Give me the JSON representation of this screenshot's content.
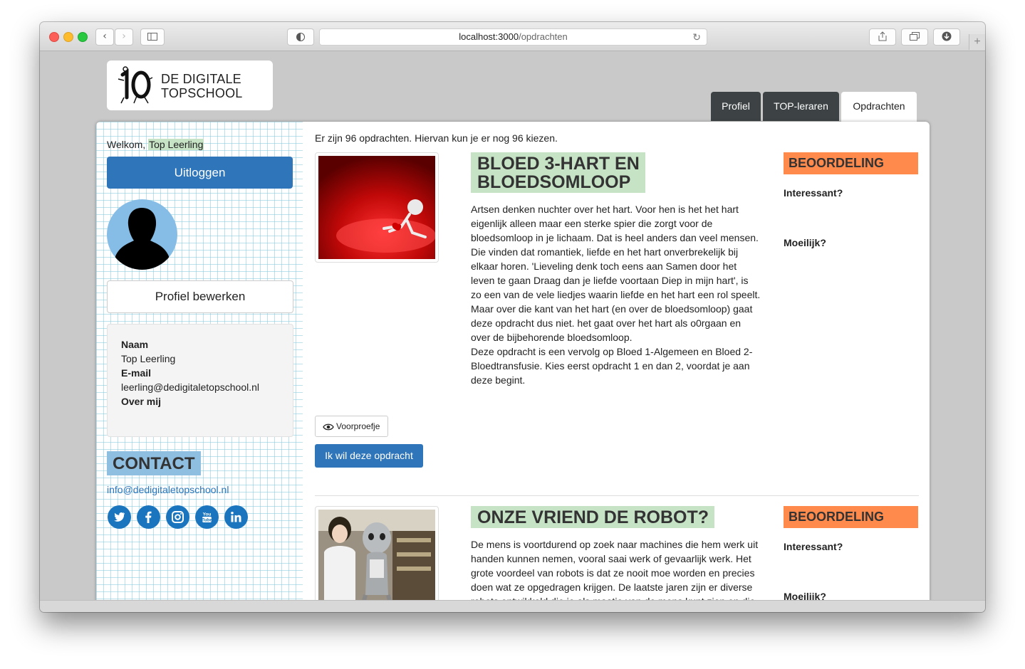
{
  "browser": {
    "url_host": "localhost:3000",
    "url_path": "/opdrachten"
  },
  "site": {
    "logo_line1": "DE DIGITALE",
    "logo_line2": "TOPSCHOOL"
  },
  "nav": {
    "tabs": [
      {
        "label": "Profiel",
        "active": false
      },
      {
        "label": "TOP-leraren",
        "active": false
      },
      {
        "label": "Opdrachten",
        "active": true
      }
    ]
  },
  "sidebar": {
    "welcome_prefix": "Welkom,",
    "user_name": "Top Leerling",
    "logout_label": "Uitloggen",
    "edit_profile_label": "Profiel bewerken",
    "profile": {
      "name_label": "Naam",
      "name_value": "Top Leerling",
      "email_label": "E-mail",
      "email_value": "leerling@dedigitaletopschool.nl",
      "about_label": "Over mij"
    },
    "contact_heading": "CONTACT",
    "contact_email": "info@dedigitaletopschool.nl",
    "social": [
      "twitter-icon",
      "facebook-icon",
      "instagram-icon",
      "youtube-icon",
      "linkedin-icon"
    ]
  },
  "main": {
    "count_text": "Er zijn 96 opdrachten. Hiervan kun je er nog 96 kiezen.",
    "assignments": [
      {
        "title_line1": "BLOED 3-HART EN",
        "title_line2": "BLOEDSOMLOOP",
        "description": [
          "Artsen denken nuchter over het hart. Voor hen is het het hart",
          "eigenlijk alleen maar een sterke spier die zorgt voor de",
          "bloedsomloop in je lichaam. Dat is heel anders dan veel mensen.",
          "Die vinden dat romantiek, liefde en het hart onverbrekelijk bij",
          "elkaar horen. 'Lieveling denk toch eens aan Samen door het",
          "leven te gaan Draag dan je liefde voortaan Diep in mijn hart',  is",
          "zo een van de vele liedjes waarin liefde en het hart een rol speelt.",
          "Maar over die kant van het hart (en over de bloedsomloop) gaat",
          "deze opdracht dus niet. het gaat over het hart als o0rgaan en",
          "over de bijbehorende bloedsomloop.",
          "Deze opdracht is een vervolg op Bloed 1-Algemeen en Bloed 2-",
          "Bloedtransfusie. Kies eerst opdracht 1 en dan 2, voordat je aan",
          "deze begint."
        ],
        "rating_heading": "BEOORDELING",
        "rating_q1": "Interessant?",
        "rating_q2": "Moeilijk?",
        "preview_label": "Voorproefje",
        "want_label": "Ik wil deze opdracht"
      },
      {
        "title_line1": "ONZE VRIEND DE ROBOT?",
        "description": [
          "De mens is voortdurend op zoek naar machines die hem werk uit",
          "handen kunnen nemen, vooral saai werk of gevaarlijk werk. Het",
          "grote voordeel van robots is dat ze nooit moe worden en precies",
          "doen wat ze opgedragen krijgen. De laatste jaren zijn er diverse",
          "robots ontwikkeld die je als maatje van de mens kunt zien en die"
        ],
        "rating_heading": "BEOORDELING",
        "rating_q1": "Interessant?",
        "rating_q2": "Moeilijk?"
      }
    ]
  },
  "colors": {
    "primary_blue": "#2f75ba",
    "title_green": "#c6e3c6",
    "rating_orange": "#ff8a4b",
    "nav_dark": "#3d4345",
    "contact_blue": "#8fbfe0"
  }
}
